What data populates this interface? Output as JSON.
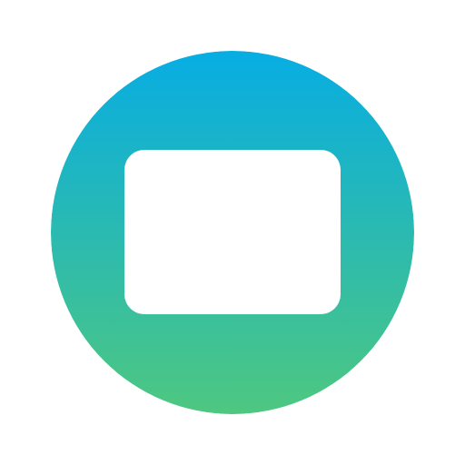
{
  "icon": {
    "name": "screen-icon",
    "colors": {
      "gradient_top": "#07ADE3",
      "gradient_bottom": "#4EC780",
      "glyph": "#FFFFFF",
      "background": "#FFFFFF"
    }
  }
}
